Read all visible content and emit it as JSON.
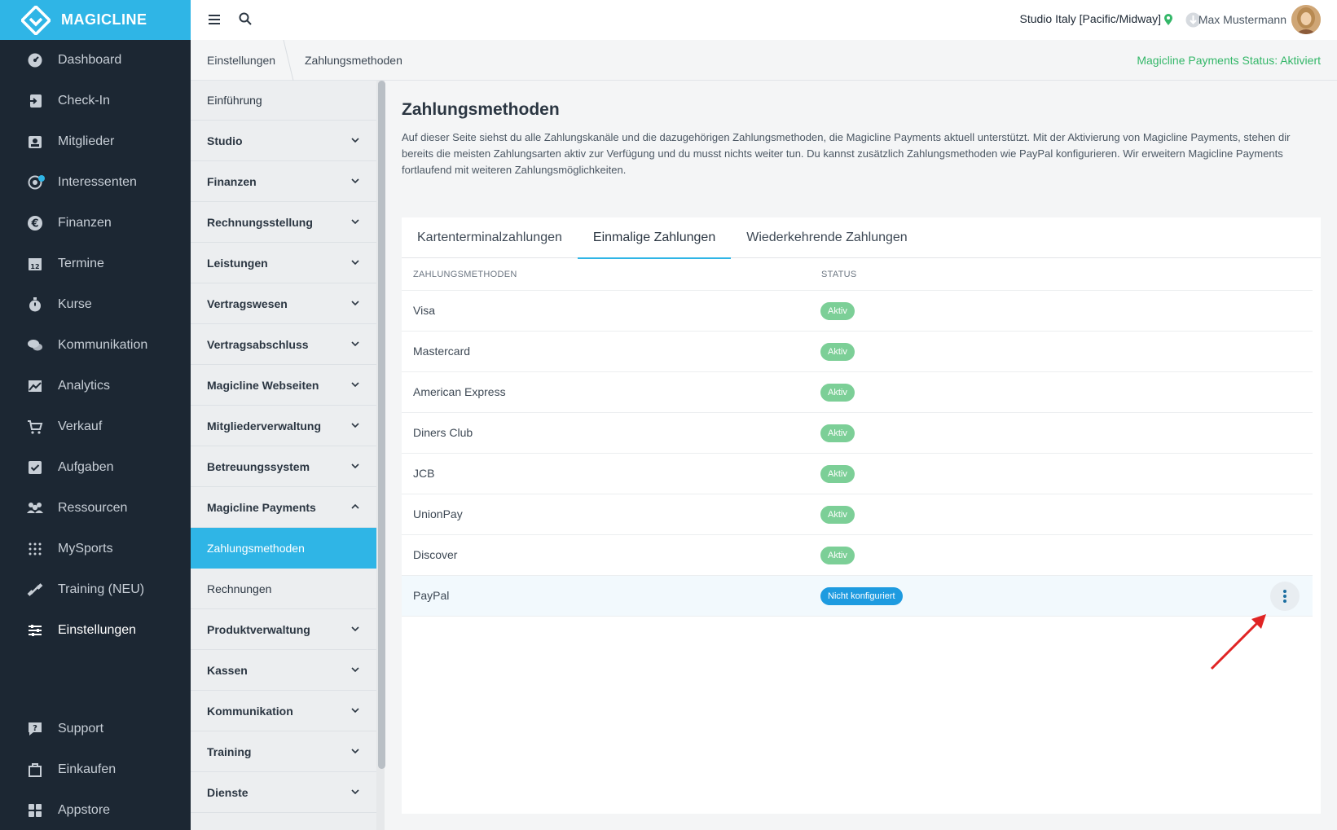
{
  "app": {
    "logo_text": "MAGICLINE"
  },
  "nav": {
    "items": [
      {
        "label": "Dashboard",
        "icon": "dashboard-icon"
      },
      {
        "label": "Check-In",
        "icon": "check-in-icon"
      },
      {
        "label": "Mitglieder",
        "icon": "members-icon"
      },
      {
        "label": "Interessenten",
        "icon": "prospects-icon"
      },
      {
        "label": "Finanzen",
        "icon": "euro-icon"
      },
      {
        "label": "Termine",
        "icon": "calendar-icon"
      },
      {
        "label": "Kurse",
        "icon": "stopwatch-icon"
      },
      {
        "label": "Kommunikation",
        "icon": "chat-icon"
      },
      {
        "label": "Analytics",
        "icon": "chart-icon"
      },
      {
        "label": "Verkauf",
        "icon": "cart-icon"
      },
      {
        "label": "Aufgaben",
        "icon": "checkbox-icon"
      },
      {
        "label": "Ressourcen",
        "icon": "people-icon"
      },
      {
        "label": "MySports",
        "icon": "dots-grid-icon"
      },
      {
        "label": "Training (NEU)",
        "icon": "dumbbell-icon"
      },
      {
        "label": "Einstellungen",
        "icon": "sliders-icon"
      }
    ],
    "bottom_items": [
      {
        "label": "Support",
        "icon": "support-icon"
      },
      {
        "label": "Einkaufen",
        "icon": "shop-icon"
      },
      {
        "label": "Appstore",
        "icon": "apps-icon"
      }
    ]
  },
  "topbar": {
    "studio": "Studio Italy [Pacific/Midway]",
    "user_name": "Max Mustermann"
  },
  "breadcrumb": {
    "items": [
      "Einstellungen",
      "Zahlungsmethoden"
    ],
    "payments_status": "Magicline Payments Status: Aktiviert"
  },
  "submenu": {
    "items": [
      "Einführung",
      "Studio",
      "Finanzen",
      "Rechnungsstellung",
      "Leistungen",
      "Vertragswesen",
      "Vertragsabschluss",
      "Magicline Webseiten",
      "Mitgliederverwaltung",
      "Betreuungssystem",
      "Magicline Payments",
      "Zahlungsmethoden",
      "Rechnungen",
      "Produktverwaltung",
      "Kassen",
      "Kommunikation",
      "Training",
      "Dienste"
    ]
  },
  "main": {
    "title": "Zahlungsmethoden",
    "description": "Auf dieser Seite siehst du alle Zahlungskanäle und die dazugehörigen Zahlungsmethoden, die Magicline Payments aktuell unterstützt. Mit der Aktivierung von Magicline Payments, stehen dir bereits die meisten Zahlungsarten aktiv zur Verfügung und du musst nichts weiter tun. Du kannst zusätzlich Zahlungsmethoden wie PayPal konfigurieren. Wir erweitern Magicline Payments fortlaufend mit weiteren Zahlungsmöglichkeiten.",
    "tabs": [
      "Kartenterminalzahlungen",
      "Einmalige Zahlungen",
      "Wiederkehrende Zahlungen"
    ],
    "table": {
      "headers": [
        "ZAHLUNGSMETHODEN",
        "STATUS"
      ],
      "rows": [
        {
          "name": "Visa",
          "status": "Aktiv"
        },
        {
          "name": "Mastercard",
          "status": "Aktiv"
        },
        {
          "name": "American Express",
          "status": "Aktiv"
        },
        {
          "name": "Diners Club",
          "status": "Aktiv"
        },
        {
          "name": "JCB",
          "status": "Aktiv"
        },
        {
          "name": "UnionPay",
          "status": "Aktiv"
        },
        {
          "name": "Discover",
          "status": "Aktiv"
        },
        {
          "name": "PayPal",
          "status": "Nicht konfiguriert"
        }
      ]
    }
  },
  "colors": {
    "brand": "#2fb5e6",
    "nav_bg": "#1c2733",
    "active_badge": "#7ccf97",
    "unconfigured_badge": "#1e9be0",
    "status_text": "#34b769",
    "annotation_arrow": "#e02424"
  }
}
